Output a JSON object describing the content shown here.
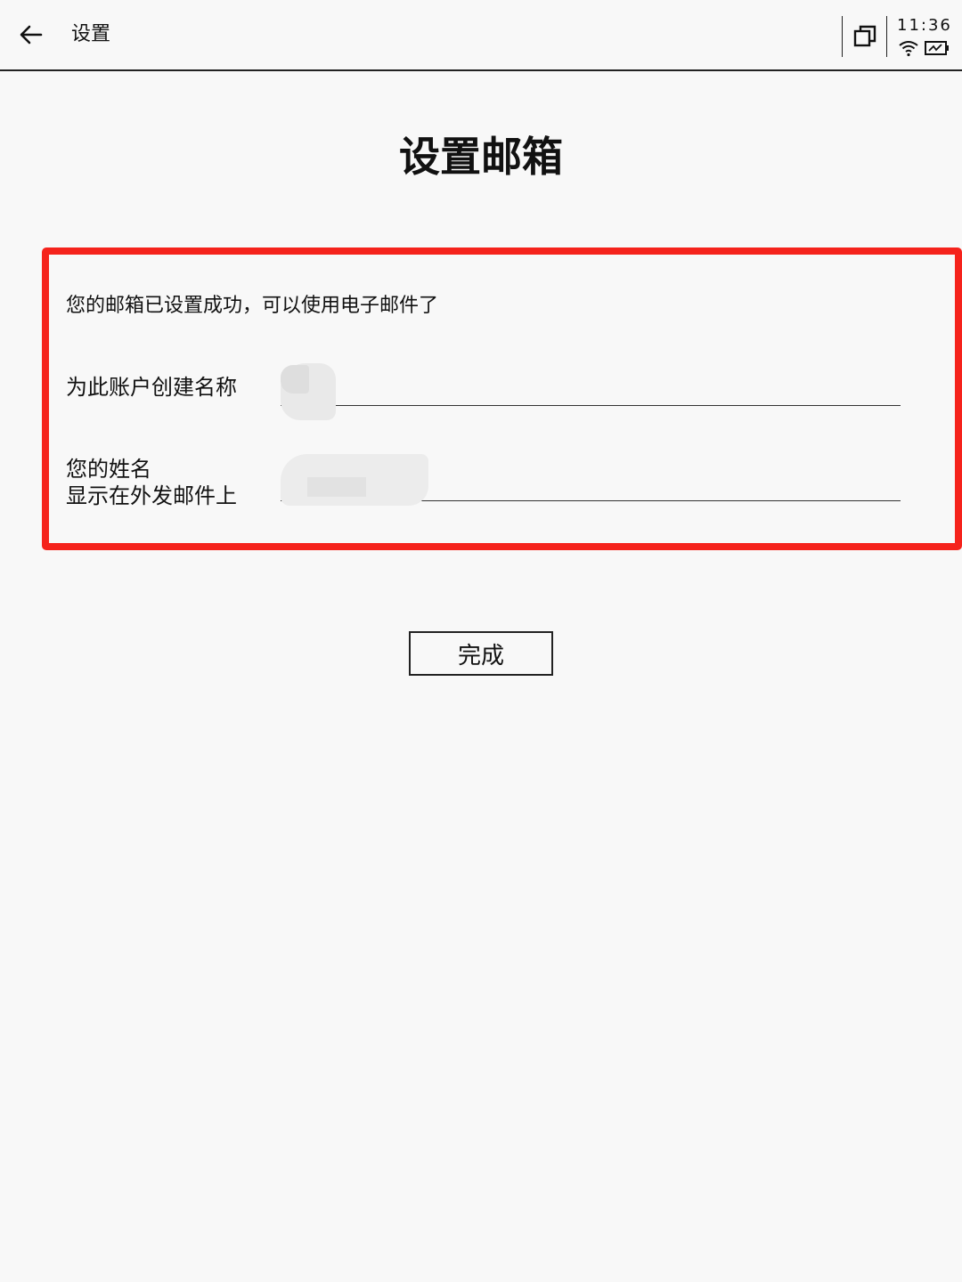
{
  "topbar": {
    "title": "设置",
    "time": "11:36",
    "icons": [
      "arrow-left-icon",
      "window-restore-icon",
      "wifi-icon",
      "battery-icon"
    ]
  },
  "page": {
    "title": "设置邮箱",
    "success_message": "您的邮箱已设置成功，可以使用电子邮件了"
  },
  "form": {
    "account_name_label": "为此账户创建名称",
    "account_name_value": "",
    "your_name_label_line1": "您的姓名",
    "your_name_label_line2": "显示在外发邮件上",
    "your_name_value": ""
  },
  "buttons": {
    "done_label": "完成"
  },
  "colors": {
    "highlight_border": "#f5231c",
    "background": "#f8f8f8"
  }
}
